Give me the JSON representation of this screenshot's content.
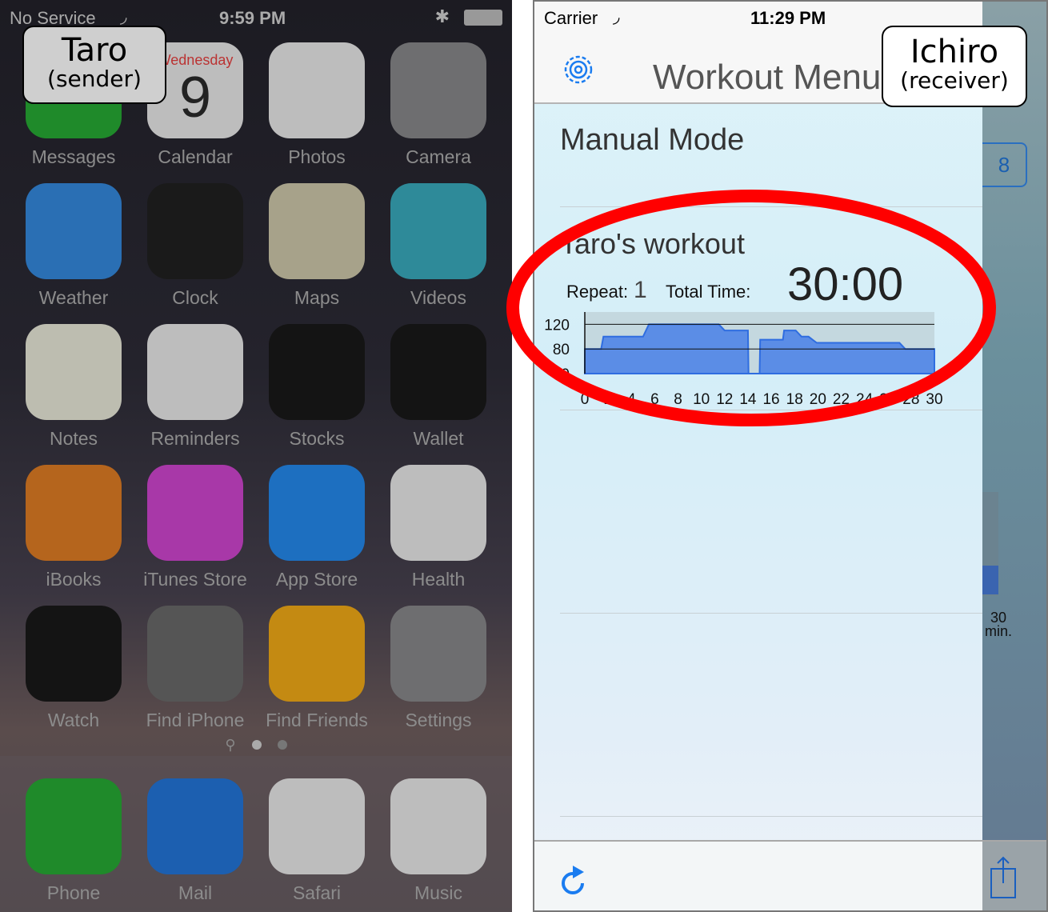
{
  "left_phone": {
    "status_bar": {
      "carrier": "No Service",
      "time": "9:59 PM"
    },
    "callout": {
      "name": "Taro",
      "role": "(sender)"
    },
    "calendar": {
      "weekday": "Wednesday",
      "day": "9"
    },
    "apps": [
      {
        "label": "Messages",
        "icon": "messages-icon",
        "color": "#1f8a2a"
      },
      {
        "label": "Calendar",
        "icon": "calendar-icon",
        "color": "#bdbdbd"
      },
      {
        "label": "Photos",
        "icon": "photos-icon",
        "color": "#bdbdbd"
      },
      {
        "label": "Camera",
        "icon": "camera-icon",
        "color": "#6e6e70"
      },
      {
        "label": "Weather",
        "icon": "weather-icon",
        "color": "#2a6fb4"
      },
      {
        "label": "Clock",
        "icon": "clock-icon",
        "color": "#1a1a1a"
      },
      {
        "label": "Maps",
        "icon": "maps-icon",
        "color": "#a7a28a"
      },
      {
        "label": "Videos",
        "icon": "videos-icon",
        "color": "#2e8a99"
      },
      {
        "label": "Notes",
        "icon": "notes-icon",
        "color": "#bdbdb0"
      },
      {
        "label": "Reminders",
        "icon": "reminders-icon",
        "color": "#bdbdbd"
      },
      {
        "label": "Stocks",
        "icon": "stocks-icon",
        "color": "#141414"
      },
      {
        "label": "Wallet",
        "icon": "wallet-icon",
        "color": "#141414"
      },
      {
        "label": "iBooks",
        "icon": "ibooks-icon",
        "color": "#b5651d"
      },
      {
        "label": "iTunes Store",
        "icon": "itunes-store-icon",
        "color": "#a838a8"
      },
      {
        "label": "App Store",
        "icon": "app-store-icon",
        "color": "#1d6fc0"
      },
      {
        "label": "Health",
        "icon": "health-icon",
        "color": "#bdbdbd"
      },
      {
        "label": "Watch",
        "icon": "watch-icon",
        "color": "#141414"
      },
      {
        "label": "Find iPhone",
        "icon": "find-iphone-icon",
        "color": "#555"
      },
      {
        "label": "Find Friends",
        "icon": "find-friends-icon",
        "color": "#c48a12"
      },
      {
        "label": "Settings",
        "icon": "settings-icon",
        "color": "#6e6e70"
      }
    ],
    "dock": [
      {
        "label": "Phone",
        "icon": "phone-icon",
        "color": "#1f8a2a"
      },
      {
        "label": "Mail",
        "icon": "mail-icon",
        "color": "#1c5fb0"
      },
      {
        "label": "Safari",
        "icon": "safari-icon",
        "color": "#bdbdbd"
      },
      {
        "label": "Music",
        "icon": "music-icon",
        "color": "#bdbdbd"
      }
    ]
  },
  "right_phone": {
    "status_bar": {
      "carrier": "Carrier",
      "time": "11:29 PM"
    },
    "callout": {
      "name": "Ichiro",
      "role": "(receiver)"
    },
    "nav_title": "Workout Menu",
    "manual_mode": "Manual Mode",
    "workout": {
      "title": "Taro's workout",
      "repeat_label": "Repeat:",
      "repeat_value": "1",
      "total_time_label": "Total Time:",
      "total_time_value": "30:00"
    },
    "side": {
      "badge": "8",
      "axis_label": "30",
      "axis_unit": "min."
    }
  },
  "chart_data": {
    "type": "area",
    "title": "",
    "xlabel": "",
    "ylabel": "",
    "y_ticks": [
      "120",
      "80",
      "0"
    ],
    "x_ticks": [
      "0",
      "2",
      "4",
      "6",
      "8",
      "10",
      "12",
      "14",
      "16",
      "18",
      "20",
      "22",
      "24",
      "26",
      "28",
      "30"
    ],
    "xlim": [
      0,
      30
    ],
    "ylim": [
      40,
      140
    ],
    "x": [
      0,
      1.4,
      1.6,
      5.0,
      5.5,
      11.5,
      12.0,
      14.0,
      14.05,
      15.0,
      15.05,
      17.0,
      17.1,
      18.1,
      18.6,
      19.2,
      19.9,
      27.0,
      27.5,
      30
    ],
    "values": [
      80,
      80,
      100,
      100,
      120,
      120,
      110,
      110,
      40,
      40,
      95,
      95,
      110,
      110,
      100,
      100,
      90,
      90,
      80,
      80
    ]
  }
}
